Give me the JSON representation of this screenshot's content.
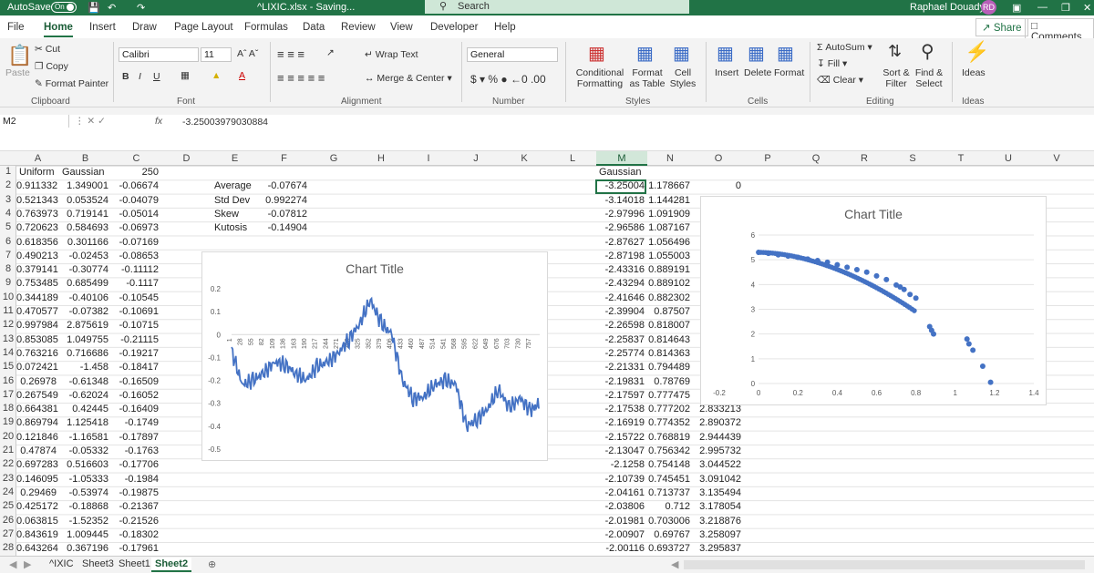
{
  "titlebar": {
    "autosave_label": "AutoSave",
    "autosave_state": "On",
    "filename": "^LIXIC.xlsx - Saving...",
    "search_placeholder": "Search",
    "user": "Raphael Douady",
    "initials": "RD"
  },
  "tabs": [
    "File",
    "Home",
    "Insert",
    "Draw",
    "Page Layout",
    "Formulas",
    "Data",
    "Review",
    "View",
    "Developer",
    "Help"
  ],
  "share_label": "Share",
  "comments_label": "Comments",
  "ribbon": {
    "clipboard": {
      "paste": "Paste",
      "cut": "Cut",
      "copy": "Copy",
      "painter": "Format Painter",
      "label": "Clipboard"
    },
    "font": {
      "name": "Calibri",
      "size": "11",
      "label": "Font"
    },
    "alignment": {
      "wrap": "Wrap Text",
      "merge": "Merge & Center",
      "label": "Alignment"
    },
    "number": {
      "format": "General",
      "label": "Number"
    },
    "styles": {
      "conditional": "Conditional Formatting",
      "table": "Format as Table",
      "cell": "Cell Styles",
      "label": "Styles"
    },
    "cells": {
      "insert": "Insert",
      "delete": "Delete",
      "format": "Format",
      "label": "Cells"
    },
    "editing": {
      "autosum": "AutoSum",
      "fill": "Fill",
      "clear": "Clear",
      "sort": "Sort & Filter",
      "find": "Find & Select",
      "label": "Editing"
    },
    "ideas": {
      "btn": "Ideas",
      "label": "Ideas"
    }
  },
  "formula_bar": {
    "name_box": "M2",
    "fx": "fx",
    "formula": "-3.25003979030884"
  },
  "columns": [
    "A",
    "B",
    "C",
    "D",
    "E",
    "F",
    "G",
    "H",
    "I",
    "J",
    "K",
    "L",
    "M",
    "N",
    "O",
    "P",
    "Q",
    "R",
    "S",
    "T",
    "U",
    "V"
  ],
  "rows": [
    "1",
    "2",
    "3",
    "4",
    "5",
    "6",
    "7",
    "8",
    "9",
    "10",
    "11",
    "12",
    "13",
    "14",
    "15",
    "16",
    "17",
    "18",
    "19",
    "20",
    "21",
    "22",
    "23",
    "24",
    "25",
    "26",
    "27",
    "28"
  ],
  "headers": {
    "a1": "Uniform",
    "b1": "Gaussian",
    "c1": "250",
    "m1": "Gaussian"
  },
  "colA": [
    "0.911332",
    "0.521343",
    "0.763973",
    "0.720623",
    "0.618356",
    "0.490213",
    "0.379141",
    "0.753485",
    "0.344189",
    "0.470577",
    "0.997984",
    "0.853085",
    "0.763216",
    "0.072421",
    "0.26978",
    "0.267549",
    "0.664381",
    "0.869794",
    "0.121846",
    "0.47874",
    "0.697283",
    "0.146095",
    "0.29469",
    "0.425172",
    "0.063815",
    "0.843619",
    "0.643264"
  ],
  "colB": [
    "1.349001",
    "0.053524",
    "0.719141",
    "0.584693",
    "0.301166",
    "-0.02453",
    "-0.30774",
    "0.685499",
    "-0.40106",
    "-0.07382",
    "2.875619",
    "1.049755",
    "0.716686",
    "-1.458",
    "-0.61348",
    "-0.62024",
    "0.42445",
    "1.125418",
    "-1.16581",
    "-0.05332",
    "0.516603",
    "-1.05333",
    "-0.53974",
    "-0.18868",
    "-1.52352",
    "1.009445",
    "0.367196"
  ],
  "colC": [
    "-0.06674",
    "-0.04079",
    "-0.05014",
    "-0.06973",
    "-0.07169",
    "-0.08653",
    "-0.11112",
    "-0.1117",
    "-0.10545",
    "-0.10691",
    "-0.10715",
    "-0.21115",
    "-0.19217",
    "-0.18417",
    "-0.16509",
    "-0.16052",
    "-0.16409",
    "-0.1749",
    "-0.17897",
    "-0.1763",
    "-0.17706",
    "-0.1984",
    "-0.19875",
    "-0.21367",
    "-0.21526",
    "-0.18302",
    "-0.17961"
  ],
  "stats": [
    {
      "label": "Average",
      "value": "-0.07674"
    },
    {
      "label": "Std Dev",
      "value": "0.992274"
    },
    {
      "label": "Skew",
      "value": "-0.07812"
    },
    {
      "label": "Kutosis",
      "value": "-0.14904"
    }
  ],
  "colM": [
    "-3.25004",
    "-3.14018",
    "-2.97996",
    "-2.96586",
    "-2.87627",
    "-2.87198",
    "-2.43316",
    "-2.43294",
    "-2.41646",
    "-2.39904",
    "-2.26598",
    "-2.25837",
    "-2.25774",
    "-2.21331",
    "-2.19831",
    "-2.17597",
    "-2.17538",
    "-2.16919",
    "-2.15722",
    "-2.13047",
    "-2.1258",
    "-2.10739",
    "-2.04161",
    "-2.03806",
    "-2.01981",
    "-2.00907",
    "-2.00116"
  ],
  "colN": [
    "1.178667",
    "1.144281",
    "1.091909",
    "1.087167",
    "1.056496",
    "1.055003",
    "0.889191",
    "0.889102",
    "0.882302",
    "0.87507",
    "0.818007",
    "0.814643",
    "0.814363",
    "0.794489",
    "0.78769",
    "0.777475",
    "0.777202",
    "0.774352",
    "0.768819",
    "0.756342",
    "0.754148",
    "0.745451",
    "0.713737",
    "0.712",
    "0.703006",
    "0.69767",
    "0.693727"
  ],
  "colO": {
    "o2": "0",
    "rest": [
      "2.833213",
      "2.890372",
      "2.944439",
      "2.995732",
      "3.044522",
      "3.091042",
      "3.135494",
      "3.178054",
      "3.218876",
      "3.258097",
      "3.295837"
    ]
  },
  "sheets": [
    "^IXIC",
    "Sheet3",
    "Sheet1",
    "Sheet2"
  ],
  "active_sheet": "Sheet2",
  "chart_data": [
    {
      "type": "line",
      "title": "Chart Title",
      "yticks": [
        "0.2",
        "0.1",
        "0",
        "-0.1",
        "-0.2",
        "-0.3",
        "-0.4",
        "-0.5"
      ],
      "ylim": [
        -0.5,
        0.2
      ],
      "xticks": [
        "1",
        "28",
        "55",
        "82",
        "109",
        "136",
        "163",
        "190",
        "217",
        "244",
        "271",
        "298",
        "325",
        "352",
        "379",
        "406",
        "433",
        "460",
        "487",
        "514",
        "541",
        "568",
        "595",
        "622",
        "649",
        "676",
        "703",
        "730",
        "757"
      ],
      "series": [
        {
          "x": [
            1,
            28,
            55,
            82,
            109,
            136,
            163,
            190,
            217,
            244,
            271,
            298,
            325,
            352,
            379,
            406,
            433,
            460,
            487,
            514,
            541,
            568,
            595,
            622,
            649,
            676,
            703,
            730,
            757,
            780
          ],
          "values": [
            -0.07,
            -0.22,
            -0.2,
            -0.17,
            -0.12,
            -0.13,
            -0.17,
            -0.2,
            -0.14,
            -0.12,
            -0.08,
            -0.02,
            0.05,
            0.15,
            0.05,
            0.0,
            -0.2,
            -0.28,
            -0.27,
            -0.22,
            -0.2,
            -0.22,
            -0.4,
            -0.37,
            -0.32,
            -0.24,
            -0.32,
            -0.28,
            -0.33,
            -0.3
          ]
        }
      ]
    },
    {
      "type": "scatter",
      "title": "Chart Title",
      "xticks": [
        "-0.2",
        "0",
        "0.2",
        "0.4",
        "0.6",
        "0.8",
        "1",
        "1.2",
        "1.4"
      ],
      "yticks": [
        "0",
        "1",
        "2",
        "3",
        "4",
        "5",
        "6"
      ],
      "xlim": [
        -0.2,
        1.4
      ],
      "ylim": [
        0,
        6
      ],
      "series": [
        {
          "x": [
            0.0,
            0.05,
            0.1,
            0.15,
            0.2,
            0.25,
            0.3,
            0.35,
            0.4,
            0.45,
            0.5,
            0.55,
            0.6,
            0.65,
            0.7,
            0.72,
            0.74,
            0.77,
            0.8,
            0.87,
            0.88,
            0.89,
            1.06,
            1.07,
            1.09,
            1.14,
            1.18
          ],
          "y": [
            5.3,
            5.26,
            5.2,
            5.15,
            5.1,
            5.03,
            4.97,
            4.9,
            4.8,
            4.7,
            4.6,
            4.5,
            4.35,
            4.2,
            3.98,
            3.9,
            3.8,
            3.6,
            3.45,
            2.3,
            2.15,
            2.0,
            1.8,
            1.6,
            1.35,
            0.7,
            0.05
          ]
        }
      ]
    }
  ]
}
